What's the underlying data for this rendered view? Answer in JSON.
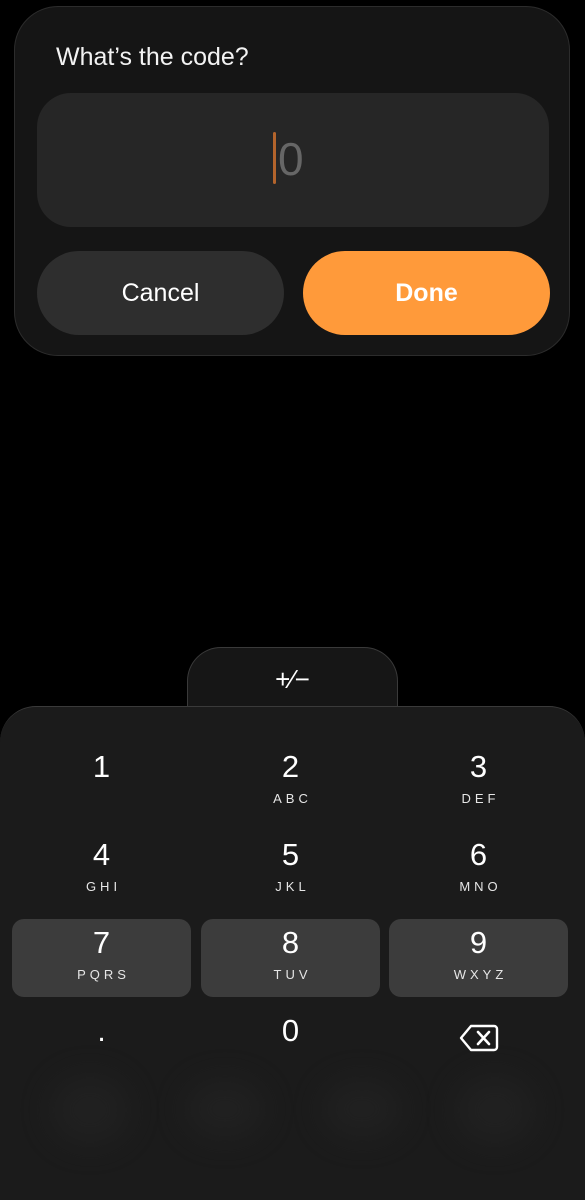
{
  "dialog": {
    "title": "What’s the code?",
    "code_value": "0",
    "cancel_label": "Cancel",
    "done_label": "Done"
  },
  "sign_toggle": {
    "label": "+∕−"
  },
  "keypad": {
    "keys": [
      {
        "num": "1",
        "letters": ""
      },
      {
        "num": "2",
        "letters": "ABC"
      },
      {
        "num": "3",
        "letters": "DEF"
      },
      {
        "num": "4",
        "letters": "GHI"
      },
      {
        "num": "5",
        "letters": "JKL"
      },
      {
        "num": "6",
        "letters": "MNO"
      },
      {
        "num": "7",
        "letters": "PQRS"
      },
      {
        "num": "8",
        "letters": "TUV"
      },
      {
        "num": "9",
        "letters": "WXYZ"
      },
      {
        "num": ".",
        "letters": ""
      },
      {
        "num": "0",
        "letters": ""
      }
    ],
    "delete_icon": "backspace-icon"
  },
  "colors": {
    "accent": "#ff9a3a",
    "dialog_bg": "#151515",
    "field_bg": "#262626",
    "keypad_bg": "#1b1b1b",
    "key_highlight": "#3c3c3c"
  }
}
